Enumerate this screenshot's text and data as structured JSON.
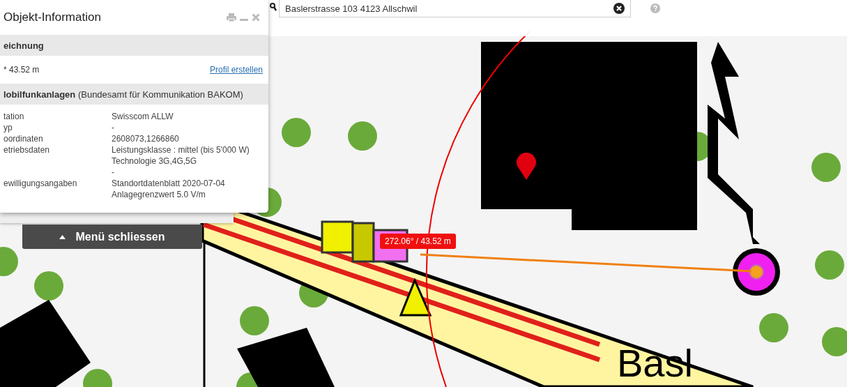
{
  "search": {
    "value": "Baslerstrasse 103 4123 Allschwil"
  },
  "panel": {
    "title": "Objekt-Information",
    "measure": {
      "heading": "eichnung",
      "value": "* 43.52 m",
      "link": "Profil erstellen"
    },
    "layer": {
      "heading": "lobilfunkanlagen",
      "note": "(Bundesamt für Kommunikation BAKOM)",
      "rows": [
        {
          "label": "tation",
          "values": [
            "Swisscom ALLW"
          ]
        },
        {
          "label": "yp",
          "values": [
            "-"
          ]
        },
        {
          "label": "oordinaten",
          "values": [
            "2608073,1266860"
          ]
        },
        {
          "label": "etriebsdaten",
          "values": [
            "Leistungsklasse : mittel (bis 5'000 W)",
            "Technologie 3G,4G,5G",
            "-"
          ]
        },
        {
          "label": "ewilligungsangaben",
          "values": [
            "Standortdatenblatt 2020-07-04",
            "Anlagegrenzwert 5.0 V/m"
          ]
        }
      ]
    }
  },
  "menu_button": {
    "label": "Menü schliessen"
  },
  "map": {
    "measure_label": "272.06° / 43.52 m",
    "street_label": "Basl"
  }
}
